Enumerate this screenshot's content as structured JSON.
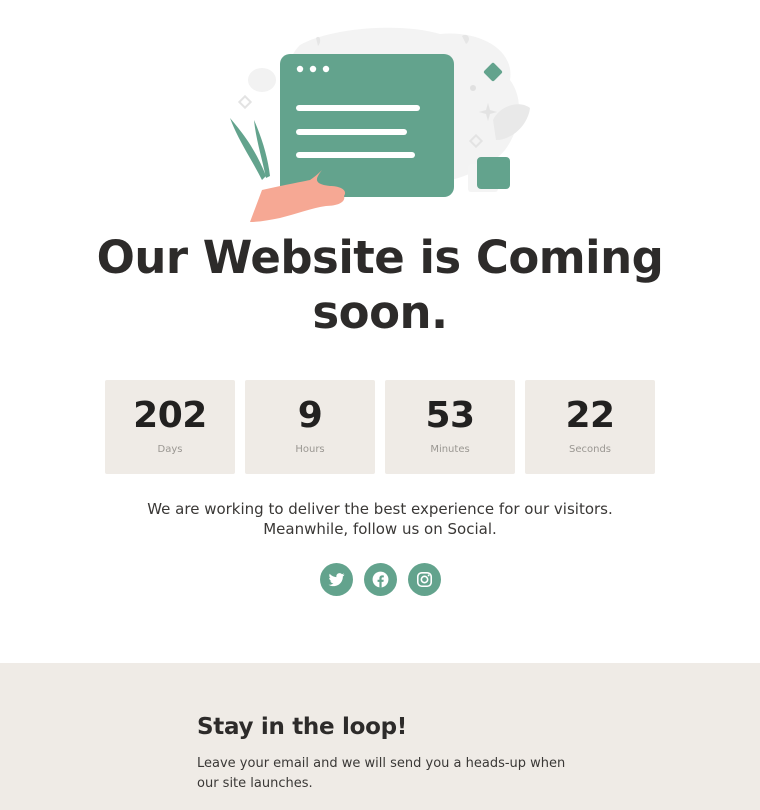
{
  "colors": {
    "accent": "#63a38d",
    "tile_background": "#efebe6",
    "heading": "#2d2b2a",
    "hand": "#f6a894"
  },
  "hero": {
    "title": "Our Website is Coming soon."
  },
  "countdown": {
    "units": [
      {
        "value": "202",
        "label": "Days"
      },
      {
        "value": "9",
        "label": "Hours"
      },
      {
        "value": "53",
        "label": "Minutes"
      },
      {
        "value": "22",
        "label": "Seconds"
      }
    ]
  },
  "message": "We are working to deliver the best experience for our visitors. Meanwhile, follow us on Social.",
  "social": {
    "items": [
      {
        "icon": "twitter-icon"
      },
      {
        "icon": "facebook-icon"
      },
      {
        "icon": "instagram-icon"
      }
    ]
  },
  "newsletter": {
    "heading": "Stay in the loop!",
    "text": "Leave your email and we will send you a heads-up when our site launches."
  }
}
